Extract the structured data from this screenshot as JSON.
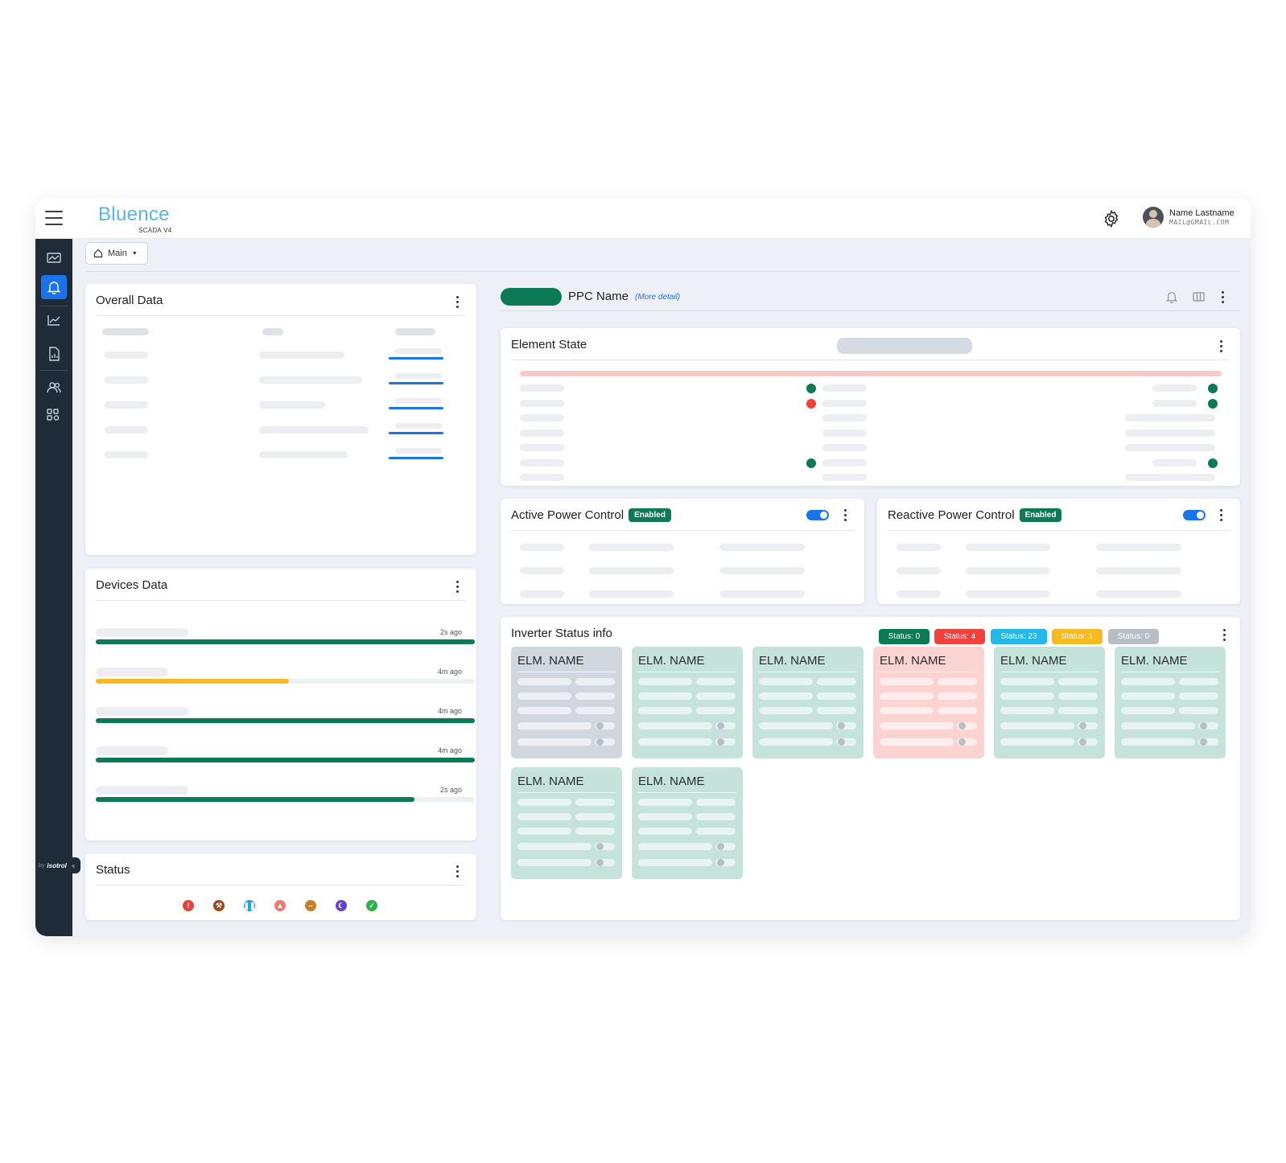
{
  "app": {
    "brand_name": "Bluence",
    "brand_sub": "SCADA V4",
    "user_name": "Name Lastname",
    "user_email": "MAIL@GMAIL.COM",
    "main_button": "Main",
    "footer_by": "by",
    "footer_brand": "isotrol"
  },
  "sidebar": {
    "items": [
      {
        "icon": "monitor-chart-icon",
        "active": false
      },
      {
        "icon": "bell-icon",
        "active": true
      },
      {
        "icon": "trend-chart-icon",
        "active": false
      },
      {
        "icon": "document-icon",
        "active": false
      },
      {
        "icon": "users-icon",
        "active": false
      },
      {
        "icon": "apps-settings-icon",
        "active": false
      }
    ]
  },
  "overall": {
    "title": "Overall Data"
  },
  "devices": {
    "title": "Devices Data",
    "rows": [
      {
        "time": "2s ago",
        "progress": 1.0,
        "color": "#0c7a55"
      },
      {
        "time": "4m ago",
        "progress": 0.51,
        "color": "#f7b924"
      },
      {
        "time": "4m ago",
        "progress": 1.0,
        "color": "#0c7a55"
      },
      {
        "time": "4m ago",
        "progress": 1.0,
        "color": "#0c7a55"
      },
      {
        "time": "2s ago",
        "progress": 0.84,
        "color": "#0c7a55"
      }
    ]
  },
  "status": {
    "title": "Status",
    "icons": [
      {
        "name": "error-icon",
        "glyph": "!",
        "color": "#e8413c"
      },
      {
        "name": "wrench-icon",
        "glyph": "⚒",
        "color": "#a0461a"
      },
      {
        "name": "pause-icon",
        "glyph": "❚❚",
        "color": "#20a7d8"
      },
      {
        "name": "warning-icon",
        "glyph": "▲",
        "color": "#ee7b72"
      },
      {
        "name": "stop-icon",
        "glyph": "–",
        "color": "#c97f2a"
      },
      {
        "name": "moon-icon",
        "glyph": "☾",
        "color": "#6b3fc9"
      },
      {
        "name": "check-icon",
        "glyph": "✓",
        "color": "#2bb34a"
      }
    ]
  },
  "ppc": {
    "name": "PPC Name",
    "more": "(More detail)"
  },
  "element_state": {
    "title": "Element State"
  },
  "active_power": {
    "title": "Active Power Control",
    "badge": "Enabled"
  },
  "reactive_power": {
    "title": "Reactive Power Control",
    "badge": "Enabled"
  },
  "inverter": {
    "title": "Inverter Status info",
    "badges": [
      {
        "label": "Status: 0",
        "color": "#0c7a55"
      },
      {
        "label": "Status: 4",
        "color": "#f0423c"
      },
      {
        "label": "Status: 23",
        "color": "#24b7e8"
      },
      {
        "label": "Status: 1",
        "color": "#f7b924"
      },
      {
        "label": "Status: 0",
        "color": "#b8bcc4"
      }
    ],
    "cards": [
      {
        "name": "ELM. NAME",
        "color": "#d2d6de"
      },
      {
        "name": "ELM. NAME",
        "color": "#c5e3db"
      },
      {
        "name": "ELM. NAME",
        "color": "#c5e3db"
      },
      {
        "name": "ELM. NAME",
        "color": "#fbd3d3"
      },
      {
        "name": "ELM. NAME",
        "color": "#c5e3db"
      },
      {
        "name": "ELM. NAME",
        "color": "#c5e3db"
      },
      {
        "name": "ELM. NAME",
        "color": "#c5e3db"
      },
      {
        "name": "ELM. NAME",
        "color": "#c5e3db"
      }
    ]
  }
}
